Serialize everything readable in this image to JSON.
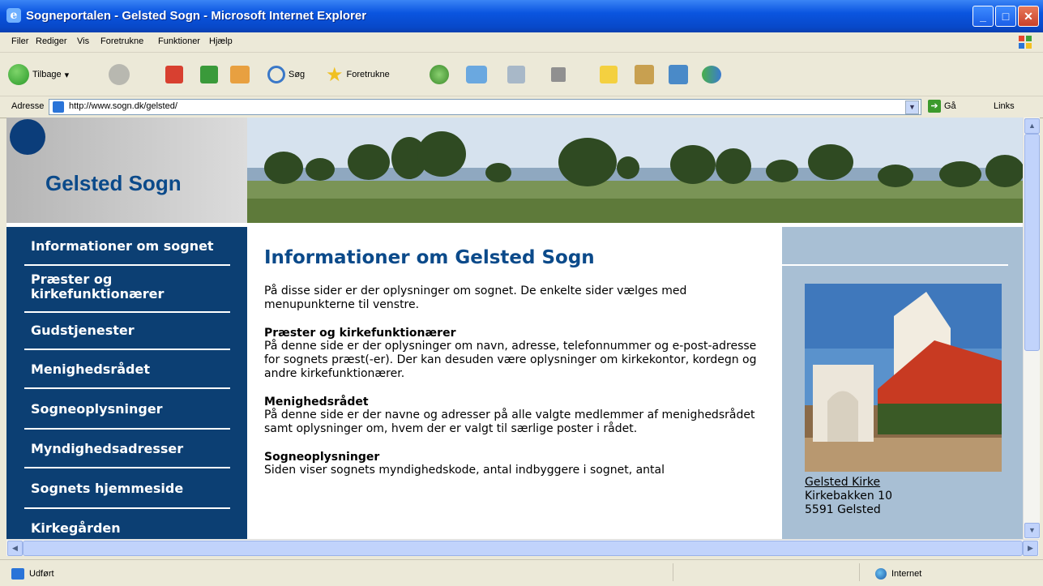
{
  "window": {
    "title": "Sogneportalen - Gelsted Sogn - Microsoft Internet Explorer"
  },
  "menu": [
    "Filer",
    "Rediger",
    "Vis",
    "Foretrukne",
    "Funktioner",
    "Hjælp"
  ],
  "toolbar": {
    "back": "Tilbage",
    "search": "Søg",
    "favorites": "Foretrukne"
  },
  "address": {
    "label": "Adresse",
    "url": "http://www.sogn.dk/gelsted/",
    "go": "Gå",
    "links": "Links"
  },
  "site": {
    "name": "Gelsted Sogn"
  },
  "nav": [
    {
      "label": "Informationer om sognet"
    },
    {
      "label": "Præster og kirkefunktionærer"
    },
    {
      "label": "Gudstjenester"
    },
    {
      "label": "Menighedsrådet"
    },
    {
      "label": "Sogneoplysninger"
    },
    {
      "label": "Myndighedsadresser"
    },
    {
      "label": "Sognets hjemmeside"
    },
    {
      "label": "Kirkegården"
    }
  ],
  "content": {
    "title": "Informationer om Gelsted Sogn",
    "intro": "På disse sider er der oplysninger om sognet. De enkelte sider vælges med menupunkterne til venstre.",
    "sections": [
      {
        "heading": "Præster og kirkefunktionærer",
        "text": "På denne side er der oplysninger om navn, adresse, telefonnummer og e-post-adresse for sognets præst(-er). Der kan desuden være oplysninger om kirkekontor, kordegn og andre kirkefunktionærer."
      },
      {
        "heading": "Menighedsrådet",
        "text": "På denne side er der navne og adresser på alle valgte medlemmer af menighedsrådet samt oplysninger om, hvem der er valgt til særlige poster i rådet."
      },
      {
        "heading": "Sogneoplysninger",
        "text": "Siden viser sognets myndighedskode, antal indbyggere i sognet, antal"
      }
    ]
  },
  "church": {
    "name": "Gelsted Kirke",
    "street": "Kirkebakken 10",
    "city": "5591 Gelsted"
  },
  "status": {
    "text": "Udført",
    "zone": "Internet"
  },
  "colors": {
    "nav_bg": "#0c3f73",
    "title_blue": "#0b4a8a",
    "sidebar_bg": "#a8bfd4"
  }
}
